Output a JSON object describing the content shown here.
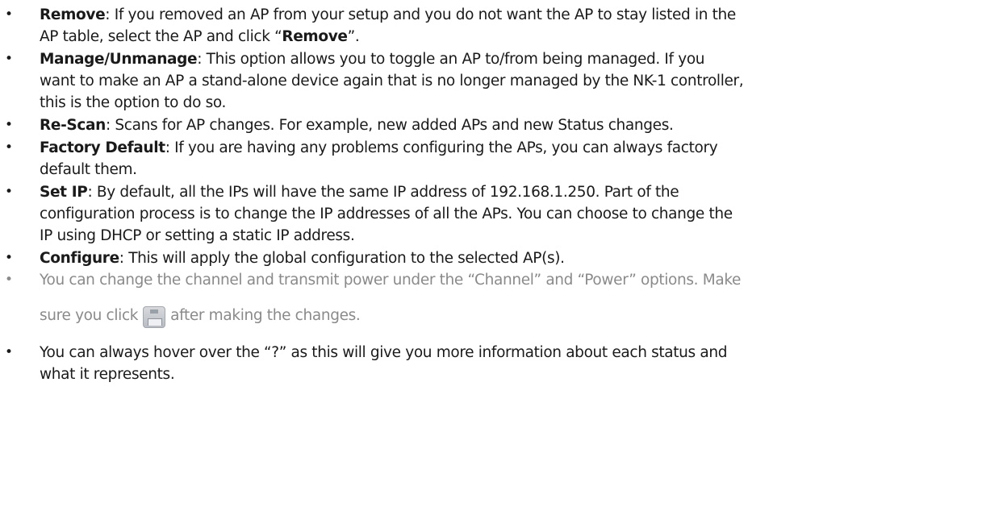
{
  "bullet_symbol": "•",
  "items": [
    {
      "term": "Remove",
      "line1": ": If you removed an AP from your setup and you do not want the AP to stay listed in the",
      "line2_a": "AP table, select the AP and click “",
      "line2_b": "Remove",
      "line2_c": "”."
    },
    {
      "term": "Manage/Unmanage",
      "line1": ": This option allows you to toggle an AP to/from being managed.  If you",
      "line2": "want to make an AP a stand-alone device again that is no longer managed by the NK-1 controller,",
      "line3": "this is the option to do so."
    },
    {
      "term": "Re-Scan",
      "line1": ": Scans for AP changes.  For example, new added APs and new Status changes."
    },
    {
      "term": "Factory Default",
      "line1": ": If you are having any problems configuring the APs, you can always factory",
      "line2": "default them."
    },
    {
      "term": "Set IP",
      "line1": ": By default, all the IPs will have the same IP address of 192.168.1.250.  Part of the",
      "line2": "configuration process is to change the IP addresses of all the APs.  You can choose to change the",
      "line3": "IP using DHCP or setting a static IP address."
    },
    {
      "term": "Configure",
      "line1": ": This will apply the global configuration to the selected AP(s)."
    },
    {
      "line1": "You can change the channel and transmit power under the “Channel” and “Power” options. Make",
      "line2_a": "sure you click",
      "line2_b": "after making the changes.",
      "icon": "save-icon"
    },
    {
      "line1": "You can always hover over the “?” as this will give you more information about each status and",
      "line2": "what it represents."
    }
  ]
}
